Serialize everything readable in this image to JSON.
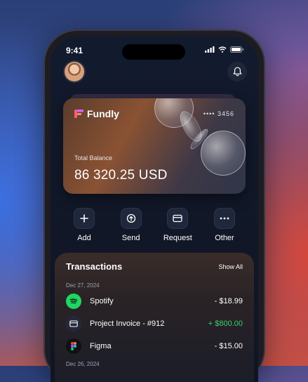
{
  "status": {
    "time": "9:41"
  },
  "card": {
    "brand": "Fundly",
    "number": "•••• 3456",
    "balance_label": "Total Balance",
    "balance": "86 320.25 USD"
  },
  "actions": [
    {
      "label": "Add",
      "icon": "plus-icon"
    },
    {
      "label": "Send",
      "icon": "send-icon"
    },
    {
      "label": "Request",
      "icon": "card-icon"
    },
    {
      "label": "Other",
      "icon": "more-icon"
    }
  ],
  "transactions": {
    "title": "Transactions",
    "show_all": "Show All",
    "groups": [
      {
        "date": "Dec 27, 2024",
        "items": [
          {
            "name": "Spotify",
            "amount": "- $18.99",
            "icon": "spotify-icon"
          },
          {
            "name": "Project Invoice - #912",
            "amount": "+ $800.00",
            "icon": "invoice-icon"
          },
          {
            "name": "Figma",
            "amount": "- $15.00",
            "icon": "figma-icon"
          }
        ]
      },
      {
        "date": "Dec 26, 2024",
        "items": []
      }
    ]
  },
  "colors": {
    "positive": "#3ccf6e",
    "spotify": "#1ed760",
    "background": "#121a2e"
  }
}
